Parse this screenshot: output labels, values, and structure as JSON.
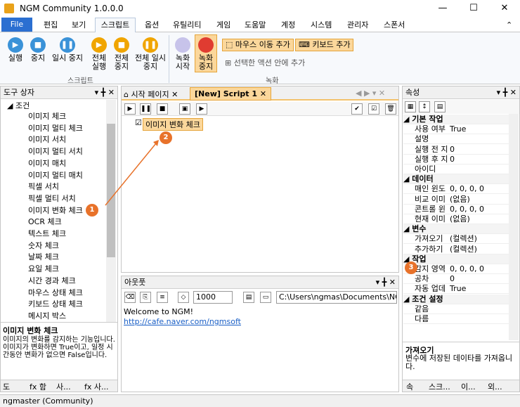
{
  "window": {
    "title": "NGM  Community 1.0.0.0",
    "minimize": "—",
    "maximize": "☐",
    "close": "✕"
  },
  "menu": {
    "file": "File",
    "tabs": [
      "편집",
      "보기",
      "스크립트",
      "옵션",
      "유틸리티",
      "게임",
      "도움말",
      "계정",
      "시스템",
      "관리자",
      "스폰서"
    ],
    "collapse": "⌃"
  },
  "ribbon": {
    "script_group": {
      "label": "스크립트",
      "buttons": [
        "실행",
        "중지",
        "일시 중지"
      ],
      "all": [
        "전체 실행",
        "전체 중지",
        "전체 일시 중지"
      ]
    },
    "record": {
      "start": "녹화 시작",
      "stop": "녹화 중지",
      "mouse_add": "마우스 이동 추가",
      "keyboard_add": "키보드 추가",
      "selected_add": "선택한 액션 안에 추가",
      "label": "녹화"
    }
  },
  "toolbox": {
    "title": "도구 상자",
    "pin": "▾ ╋ ✕",
    "category": "조건",
    "items": [
      "이미지 체크",
      "이미지 멀티 체크",
      "이미지 서치",
      "이미지 멀티 서치",
      "이미지 매치",
      "이미지 멀티 매치",
      "픽셀 서치",
      "픽셀 멀티 서치",
      "이미지 변화 체크",
      "OCR 체크",
      "텍스트 체크",
      "숫자 체크",
      "날짜 체크",
      "요일 체크",
      "시간 경과 체크",
      "마우스 상태 체크",
      "키보드 상태 체크",
      "메시지 박스"
    ],
    "desc_title": "이미지 변화 체크",
    "desc": "이미지의 변화를 감지하는 기능입니다. 이미지가 변화하면 True이고, 일정 시간동안 변화가 없으면 False입니다.",
    "bottom_tabs": [
      "도",
      "fx 함",
      "사...",
      "fx 사..."
    ]
  },
  "doc": {
    "tabs": [
      "시작 페이지",
      "[New] Script 1"
    ],
    "close": "✕",
    "node": "이미지 변화 체크",
    "checkbox": "☑"
  },
  "output": {
    "title": "아웃풋",
    "num": "1000",
    "path": "C:\\Users\\ngmas\\Documents\\NGM5\\",
    "welcome": "Welcome to NGM!",
    "link": "http://cafe.naver.com/ngmsoft"
  },
  "props": {
    "title": "속성",
    "rows": [
      {
        "cat": "기본 작업"
      },
      {
        "k": "사용 여부",
        "v": "True"
      },
      {
        "k": "설명",
        "v": ""
      },
      {
        "k": "실행 전 지",
        "v": "0"
      },
      {
        "k": "실행 후 지",
        "v": "0"
      },
      {
        "k": "아이디",
        "v": ""
      },
      {
        "cat": "데이터"
      },
      {
        "k": "매인 윈도",
        "v": "0, 0, 0, 0"
      },
      {
        "k": "비교 이미",
        "v": "(없음)"
      },
      {
        "k": "콘트롤 윈",
        "v": "0, 0, 0, 0"
      },
      {
        "k": "현재 이미",
        "v": "(없음)"
      },
      {
        "cat": "변수"
      },
      {
        "k": "가져오기",
        "v": "(컬렉션)"
      },
      {
        "k": "추가하기",
        "v": "(컬렉션)"
      },
      {
        "cat": "작업"
      },
      {
        "k": "감지 영역",
        "v": "0, 0, 0, 0"
      },
      {
        "k": "공차",
        "v": "0"
      },
      {
        "k": "자동 업데",
        "v": "True"
      },
      {
        "cat": "조건 설정"
      },
      {
        "k": "같음",
        "v": ""
      },
      {
        "k": "다름",
        "v": ""
      }
    ],
    "desc_title": "가져오기",
    "desc": "변수에 저장된 데이타를 가져옵니다.",
    "bottom_tabs": [
      "속",
      "스크...",
      "이...",
      "외..."
    ]
  },
  "status": "ngmaster (Community)",
  "badges": [
    "1",
    "2",
    "3"
  ]
}
